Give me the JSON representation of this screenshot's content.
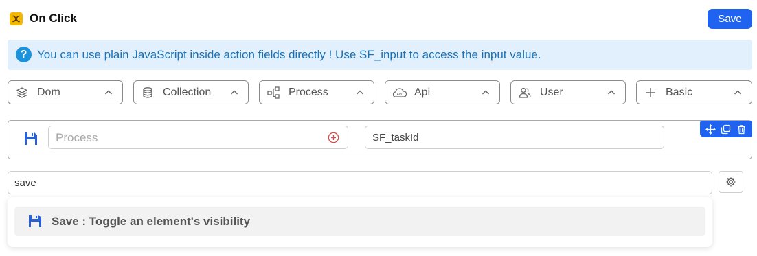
{
  "header": {
    "title": "On Click",
    "title_icon": "x-variable-icon",
    "save_label": "Save",
    "accent": "#1f63f0",
    "title_icon_color": "#f5b800"
  },
  "info": {
    "icon": "question-circle-icon",
    "text": "You can use plain JavaScript inside action fields directly ! Use SF_input to access the input value.",
    "background": "#e2f0fd",
    "text_color": "#1a73b8"
  },
  "tabs": [
    {
      "label": "Dom",
      "icon": "layers-icon"
    },
    {
      "label": "Collection",
      "icon": "database-icon"
    },
    {
      "label": "Process",
      "icon": "flow-icon"
    },
    {
      "label": "Api",
      "icon": "api-cloud-icon"
    },
    {
      "label": "User",
      "icon": "users-icon"
    },
    {
      "label": "Basic",
      "icon": "plus-icon"
    }
  ],
  "action": {
    "icon": "floppy-disk-icon",
    "process_placeholder": "Process",
    "process_value": "",
    "task_value": "SF_taskId",
    "toolbar": [
      "move-icon",
      "copy-icon",
      "trash-icon"
    ]
  },
  "search": {
    "value": "save"
  },
  "results": [
    {
      "label": "Save : Toggle an element's visibility",
      "icon": "floppy-disk-icon"
    }
  ]
}
